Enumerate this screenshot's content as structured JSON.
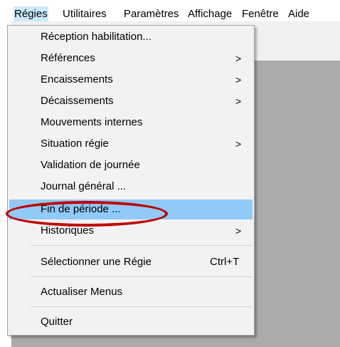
{
  "menubar": {
    "items": [
      "Régies",
      "Utilitaires",
      "Paramètres",
      "Affichage",
      "Fenêtre",
      "Aide"
    ]
  },
  "menu": {
    "items": [
      {
        "label": "Réception habilitation...",
        "arrow": ""
      },
      {
        "label": "Références",
        "arrow": ">"
      },
      {
        "label": "Encaissements",
        "arrow": ">"
      },
      {
        "label": "Décaissements",
        "arrow": ">"
      },
      {
        "label": "Mouvements internes",
        "arrow": ""
      },
      {
        "label": "Situation régie",
        "arrow": ">"
      },
      {
        "label": "Validation de journée",
        "arrow": ""
      },
      {
        "label": "Journal général ...",
        "arrow": ""
      },
      {
        "label": "Fin de période ...",
        "arrow": ""
      },
      {
        "label": "Historiques",
        "arrow": ">"
      },
      {
        "label": "Sélectionner une Régie",
        "shortcut": "Ctrl+T"
      },
      {
        "label": "Actualiser Menus"
      },
      {
        "label": "Quitter"
      }
    ]
  },
  "colors": {
    "highlight": "#91c9f7",
    "annotation": "#c00000",
    "workspace": "#ababab"
  }
}
